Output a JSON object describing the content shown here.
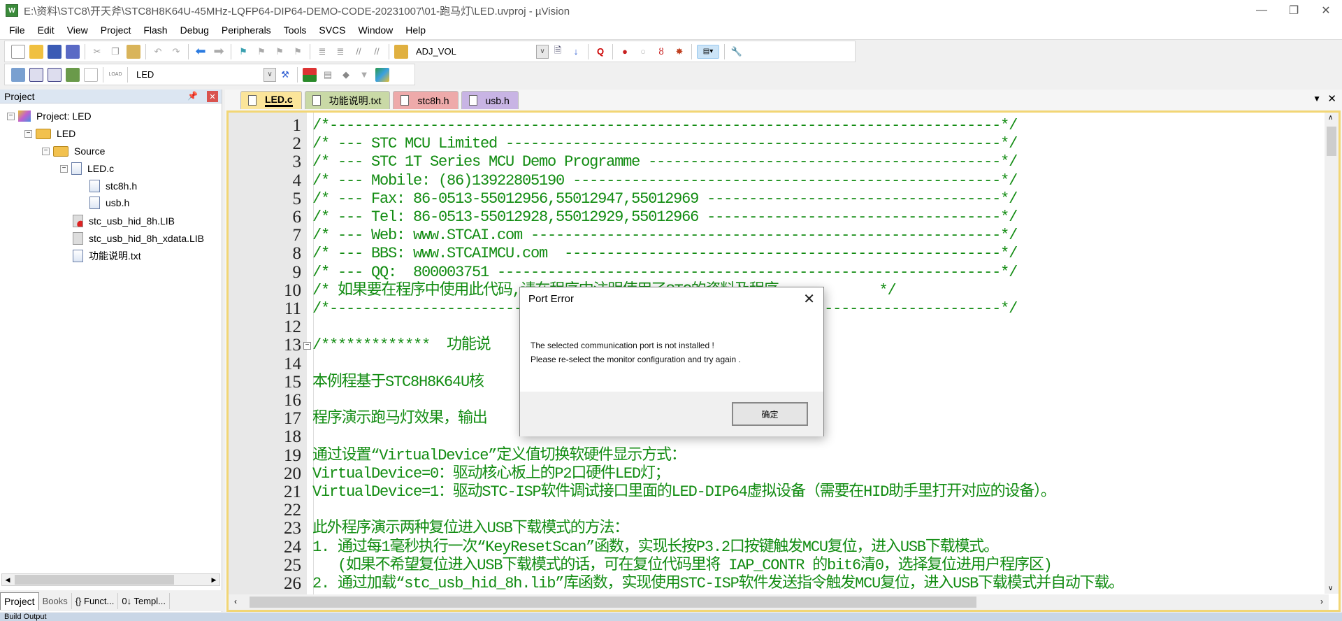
{
  "window": {
    "title": "E:\\资料\\STC8\\开天斧\\STC8H8K64U-45MHz-LQFP64-DIP64-DEMO-CODE-20231007\\01-跑马灯\\LED.uvproj - µVision",
    "app_icon": "W",
    "minimize": "—",
    "maximize": "❐",
    "close": "✕"
  },
  "menu": [
    "File",
    "Edit",
    "View",
    "Project",
    "Flash",
    "Debug",
    "Peripherals",
    "Tools",
    "SVCS",
    "Window",
    "Help"
  ],
  "toolbar": {
    "find_combo": "ADJ_VOL",
    "target_combo": "LED",
    "load_label": "LOAD"
  },
  "project": {
    "title": "Project",
    "tree": [
      {
        "label": "Project: LED",
        "type": "project"
      },
      {
        "label": "LED",
        "type": "target"
      },
      {
        "label": "Source",
        "type": "folder"
      },
      {
        "label": "LED.c",
        "type": "file"
      },
      {
        "label": "stc8h.h",
        "type": "file"
      },
      {
        "label": "usb.h",
        "type": "file"
      },
      {
        "label": "stc_usb_hid_8h.LIB",
        "type": "lib"
      },
      {
        "label": "stc_usb_hid_8h_xdata.LIB",
        "type": "lib"
      },
      {
        "label": "功能说明.txt",
        "type": "file"
      }
    ],
    "bottom_tabs": [
      "Project",
      "Books",
      "{} Funct...",
      "0↓ Templ..."
    ]
  },
  "editor": {
    "tabs": [
      {
        "label": "LED.c",
        "color": "#fbe59a"
      },
      {
        "label": "功能说明.txt",
        "color": "#c9d9a6"
      },
      {
        "label": "stc8h.h",
        "color": "#eeaaaa"
      },
      {
        "label": "usb.h",
        "color": "#c8b4e4"
      }
    ],
    "lines": [
      "/*--------------------------------------------------------------------------------*/",
      "/* --- STC MCU Limited -----------------------------------------------------------*/",
      "/* --- STC 1T Series MCU Demo Programme ------------------------------------------*/",
      "/* --- Mobile: (86)13922805190 ---------------------------------------------------*/",
      "/* --- Fax: 86-0513-55012956,55012947,55012969 -----------------------------------*/",
      "/* --- Tel: 86-0513-55012928,55012929,55012966 -----------------------------------*/",
      "/* --- Web: www.STCAI.com --------------------------------------------------------*/",
      "/* --- BBS: www.STCAIMCU.com  ----------------------------------------------------*/",
      "/* --- QQ:  800003751 ------------------------------------------------------------*/",
      "/* 如果要在程序中使用此代码,请在程序中注明使用了STC的资料及程序            */",
      "/*--------------------------------------------------------------------------------*/",
      "",
      "/*************  功能说",
      "",
      "本例程基于STC8H8K64U核",
      "",
      "程序演示跑马灯效果，输出",
      "",
      "通过设置“VirtualDevice”定义值切换软硬件显示方式：",
      "VirtualDevice=0：驱动核心板上的P2口硬件LED灯；",
      "VirtualDevice=1：驱动STC-ISP软件调试接口里面的LED-DIP64虚拟设备（需要在HID助手里打开对应的设备）。",
      "",
      "此外程序演示两种复位进入USB下载模式的方法：",
      "1. 通过每1毫秒执行一次“KeyResetScan”函数，实现长按P3.2口按键触发MCU复位，进入USB下载模式。",
      "   (如果不希望复位进入USB下载模式的话，可在复位代码里将 IAP_CONTR 的bit6清0，选择复位进用户程序区)",
      "2. 通过加载“stc_usb_hid_8h.lib”库函数，实现使用STC-ISP软件发送指令触发MCU复位，进入USB下载模式并自动下载。"
    ]
  },
  "bottom_panel": {
    "title": "Build Output"
  },
  "dialog": {
    "title": "Port Error",
    "message_line1": "The selected communication port is not installed !",
    "message_line2": "Please re-select the monitor configuration and try again .",
    "ok_label": "确定",
    "close": "✕"
  }
}
